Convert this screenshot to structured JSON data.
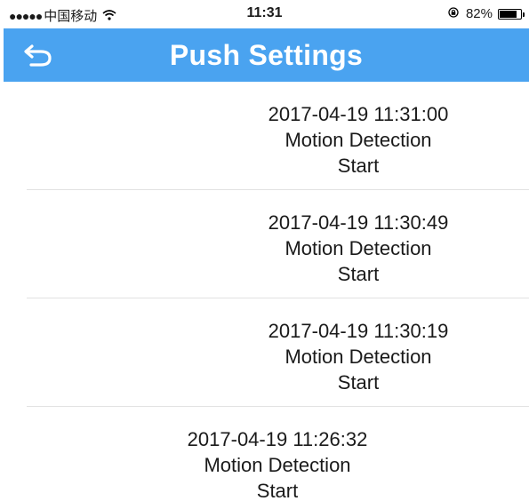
{
  "status_bar": {
    "carrier": "中国移动",
    "time": "11:31",
    "battery": "82%",
    "battery_level": 0.82
  },
  "nav": {
    "back_icon": "back-arrow-icon",
    "title": "Push Settings"
  },
  "events": [
    {
      "datetime": "2017-04-19 11:31:00",
      "type": "Motion Detection",
      "status": "Start"
    },
    {
      "datetime": "2017-04-19 11:30:49",
      "type": "Motion Detection",
      "status": "Start"
    },
    {
      "datetime": "2017-04-19 11:30:19",
      "type": "Motion Detection",
      "status": "Start"
    },
    {
      "datetime": "2017-04-19 11:26:32",
      "type": "Motion Detection",
      "status": "Start"
    }
  ]
}
